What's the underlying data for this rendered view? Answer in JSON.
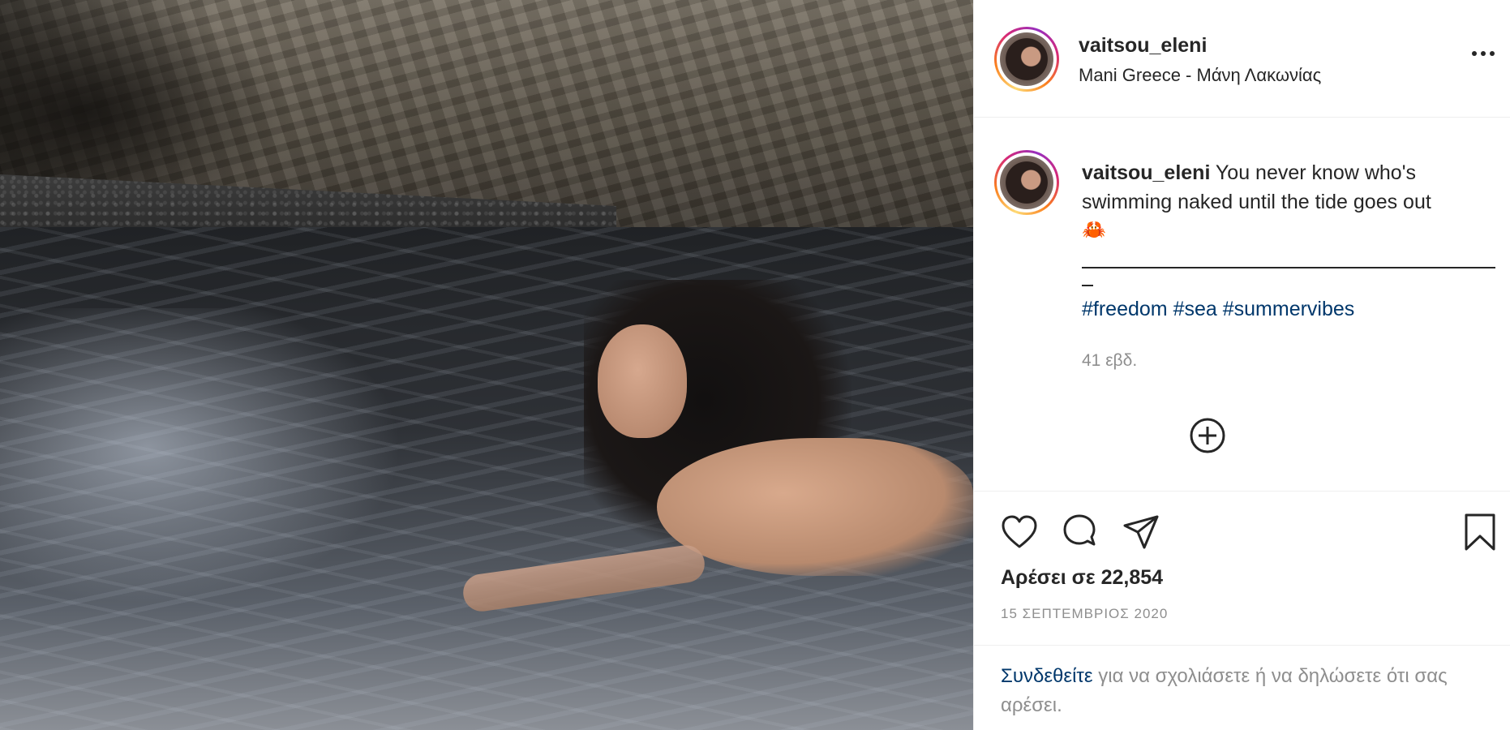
{
  "post": {
    "username": "vaitsou_eleni",
    "location": "Mani Greece - Μάνη Λακωνίας",
    "more_icon": "more-horizontal-icon",
    "caption": {
      "username": "vaitsou_eleni",
      "text": "You never know who's swimming naked until the tide goes out",
      "emoji": "🦀",
      "underscore": "_",
      "hashtags": [
        "#freedom",
        "#sea",
        "#summervibes"
      ]
    },
    "age": "41 εβδ.",
    "load_more_icon": "plus-circle-icon",
    "actions": {
      "icons": [
        "heart-icon",
        "comment-icon",
        "share-icon",
        "bookmark-icon"
      ]
    },
    "likes_text": "Αρέσει σε 22,854",
    "date": "15 ΣΕΠΤΕΜΒΡΙΟΣ 2020",
    "login": {
      "link": "Συνδεθείτε",
      "rest": " για να σχολιάσετε ή να δηλώσετε ότι σας αρέσει."
    }
  },
  "colors": {
    "text": "#262626",
    "secondary": "#8e8e8e",
    "link": "#00376b",
    "border": "#efefef"
  }
}
